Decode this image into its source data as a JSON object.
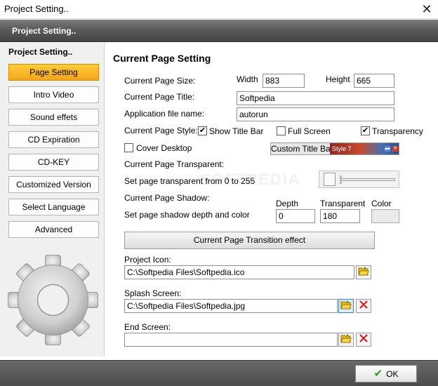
{
  "window": {
    "title": "Project Setting..",
    "close_glyph": "✕"
  },
  "header": {
    "title": "Project Setting.."
  },
  "sidebar": {
    "title": "Project Setting..",
    "items": [
      {
        "label": "Page Setting",
        "active": true
      },
      {
        "label": "Intro Video"
      },
      {
        "label": "Sound effets"
      },
      {
        "label": "CD Expiration"
      },
      {
        "label": "CD-KEY"
      },
      {
        "label": "Customized Version"
      },
      {
        "label": "Select Language"
      },
      {
        "label": "Advanced"
      }
    ]
  },
  "page": {
    "title": "Current Page Setting",
    "size_label": "Current Page Size:",
    "width_label": "Width",
    "width_value": "883",
    "height_label": "Height",
    "height_value": "665",
    "title_label": "Current Page Title:",
    "title_value": "Softpedia",
    "app_label": "Application file name:",
    "app_value": "autorun",
    "style_label": "Current Page Style:",
    "show_title_bar": {
      "label": "Show Title Bar",
      "checked": true
    },
    "full_screen": {
      "label": "Full Screen",
      "checked": false
    },
    "transparency": {
      "label": "Transparency",
      "checked": true
    },
    "cover_desktop": {
      "label": "Cover Desktop",
      "checked": false
    },
    "custom_title_bar_label": "Custom Title Bar",
    "style_preview_text": "Style 7",
    "transparent_label": "Current Page Transparent:",
    "transparent_range_label": "Set page transparent from 0 to 255",
    "transparent_slider_fraction": 0.0,
    "shadow_label": "Current Page Shadow:",
    "shadow_desc": "Set page shadow depth and color",
    "depth_label": "Depth",
    "depth_value": "0",
    "shadow_transparent_label": "Transparent",
    "shadow_transparent_value": "180",
    "color_label": "Color",
    "transition_button": "Current Page Transition effect",
    "project_icon_label": "Project Icon:",
    "project_icon_value": "C:\\Softpedia Files\\Softpedia.ico",
    "splash_label": "Splash Screen:",
    "splash_value": "C:\\Softpedia Files\\Softpedia.jpg",
    "end_label": "End Screen:",
    "end_value": ""
  },
  "footer": {
    "ok_label": "OK"
  },
  "colors": {
    "active_tab": "#f3a51c",
    "header": "#5a5a5a",
    "ok_check": "#2c9a1d",
    "delete_x": "#cc2222"
  },
  "icons": [
    "close-icon",
    "gear-icon",
    "open-folder-icon",
    "delete-icon",
    "checkmark-icon"
  ]
}
